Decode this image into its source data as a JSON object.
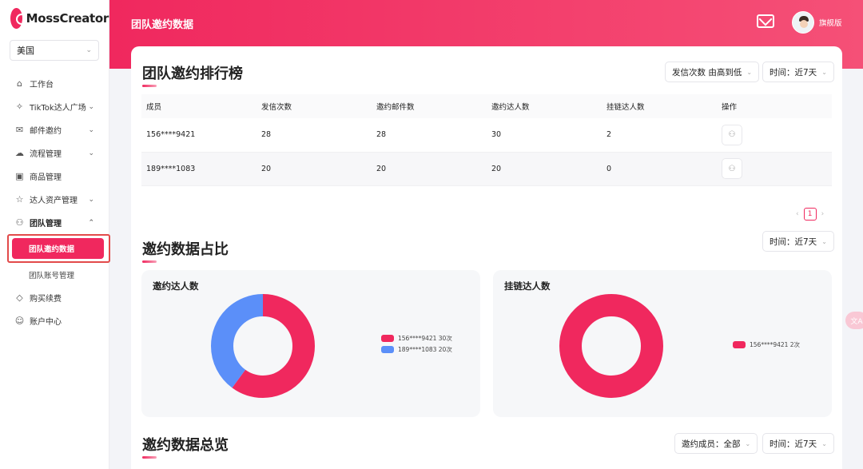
{
  "app": {
    "name": "MossCreator",
    "plan": "旗舰版"
  },
  "sidebar": {
    "country": "美国",
    "items": [
      {
        "label": "工作台"
      },
      {
        "label": "TikTok达人广场"
      },
      {
        "label": "邮件邀约"
      },
      {
        "label": "流程管理"
      },
      {
        "label": "商品管理"
      },
      {
        "label": "达人资产管理"
      },
      {
        "label": "团队管理"
      },
      {
        "label": "购买续费"
      },
      {
        "label": "账户中心"
      }
    ],
    "sub_items": [
      {
        "label": "团队邀约数据"
      },
      {
        "label": "团队账号管理"
      }
    ]
  },
  "header": {
    "title": "团队邀约数据"
  },
  "ranking": {
    "title": "团队邀约排行榜",
    "sort_select": "发信次数 由高到低",
    "time_select": "时间：近7天",
    "columns": [
      "成员",
      "发信次数",
      "邀约邮件数",
      "邀约达人数",
      "挂链达人数",
      "操作"
    ],
    "rows": [
      [
        "156****9421",
        "28",
        "28",
        "30",
        "2"
      ],
      [
        "189****1083",
        "20",
        "20",
        "20",
        "0"
      ]
    ],
    "page": "1"
  },
  "ratio": {
    "title": "邀约数据占比",
    "time_select": "时间：近7天",
    "charts": [
      {
        "title": "邀约达人数",
        "segments": [
          {
            "label": "156****9421 30次",
            "value": 30,
            "color": "#f0285e"
          },
          {
            "label": "189****1083 20次",
            "value": 20,
            "color": "#5b8ff9"
          }
        ]
      },
      {
        "title": "挂链达人数",
        "segments": [
          {
            "label": "156****9421 2次",
            "value": 2,
            "color": "#f0285e"
          }
        ]
      }
    ]
  },
  "overview": {
    "title": "邀约数据总览",
    "member_select": "邀约成员：全部",
    "time_select": "时间：近7天"
  },
  "chart_data": [
    {
      "type": "pie",
      "title": "邀约达人数",
      "categories": [
        "156****9421",
        "189****1083"
      ],
      "values": [
        30,
        20
      ]
    },
    {
      "type": "pie",
      "title": "挂链达人数",
      "categories": [
        "156****9421"
      ],
      "values": [
        2
      ]
    }
  ],
  "float_button": {
    "label": "文A"
  }
}
